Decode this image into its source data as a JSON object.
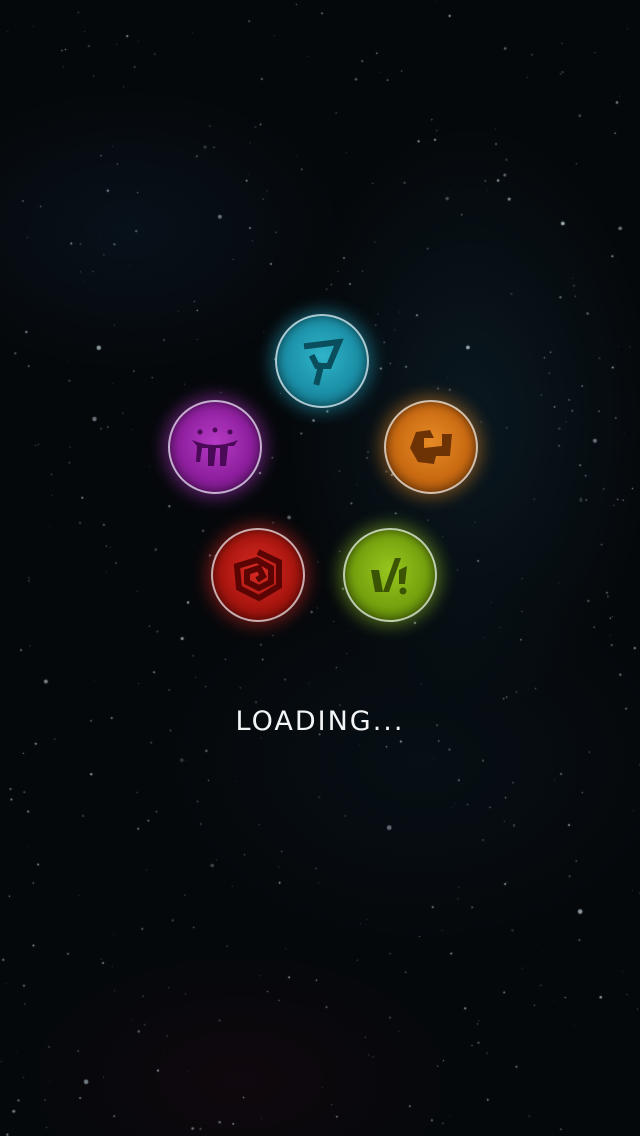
{
  "loading": {
    "label": "LOADING..."
  },
  "emblems": [
    {
      "id": "cyan",
      "color": "#1b8fa6",
      "glyph_color": "#0a4e5e",
      "icon": "cyan-rune-icon"
    },
    {
      "id": "orange",
      "color": "#c96a12",
      "glyph_color": "#6e3304",
      "icon": "orange-rune-icon"
    },
    {
      "id": "purple",
      "color": "#8e1f9e",
      "glyph_color": "#4b0a57",
      "icon": "purple-rune-icon"
    },
    {
      "id": "red",
      "color": "#a9160f",
      "glyph_color": "#5a0504",
      "icon": "red-spiral-rune-icon"
    },
    {
      "id": "green",
      "color": "#74a10e",
      "glyph_color": "#3a5404",
      "icon": "green-rune-icon"
    }
  ],
  "background": {
    "color": "#05080b"
  }
}
